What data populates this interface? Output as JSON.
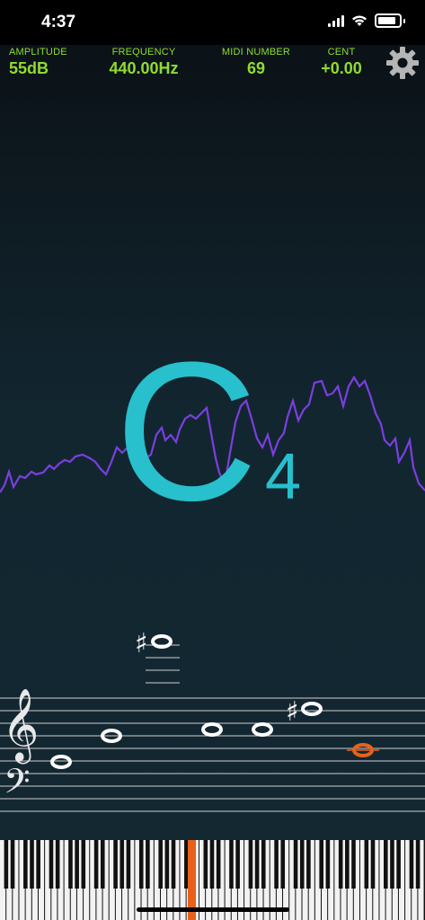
{
  "status_bar": {
    "time": "4:37"
  },
  "stats": [
    {
      "label": "AMPLITUDE",
      "value": "55dB"
    },
    {
      "label": "FREQUENCY",
      "value": "440.00Hz"
    },
    {
      "label": "MIDI NUMBER",
      "value": "69"
    },
    {
      "label": "CENT",
      "value": "+0.00"
    }
  ],
  "note": {
    "name": "C",
    "octave": "4"
  },
  "colors": {
    "accent": "#8fdc2f",
    "note": "#27c0cc",
    "wave": "#7b3fe0",
    "highlight": "#e8611a"
  },
  "icons": [
    "wifi-icon",
    "battery-icon",
    "gear-icon",
    "treble-clef-icon",
    "bass-clef-icon",
    "sharp-icon"
  ]
}
